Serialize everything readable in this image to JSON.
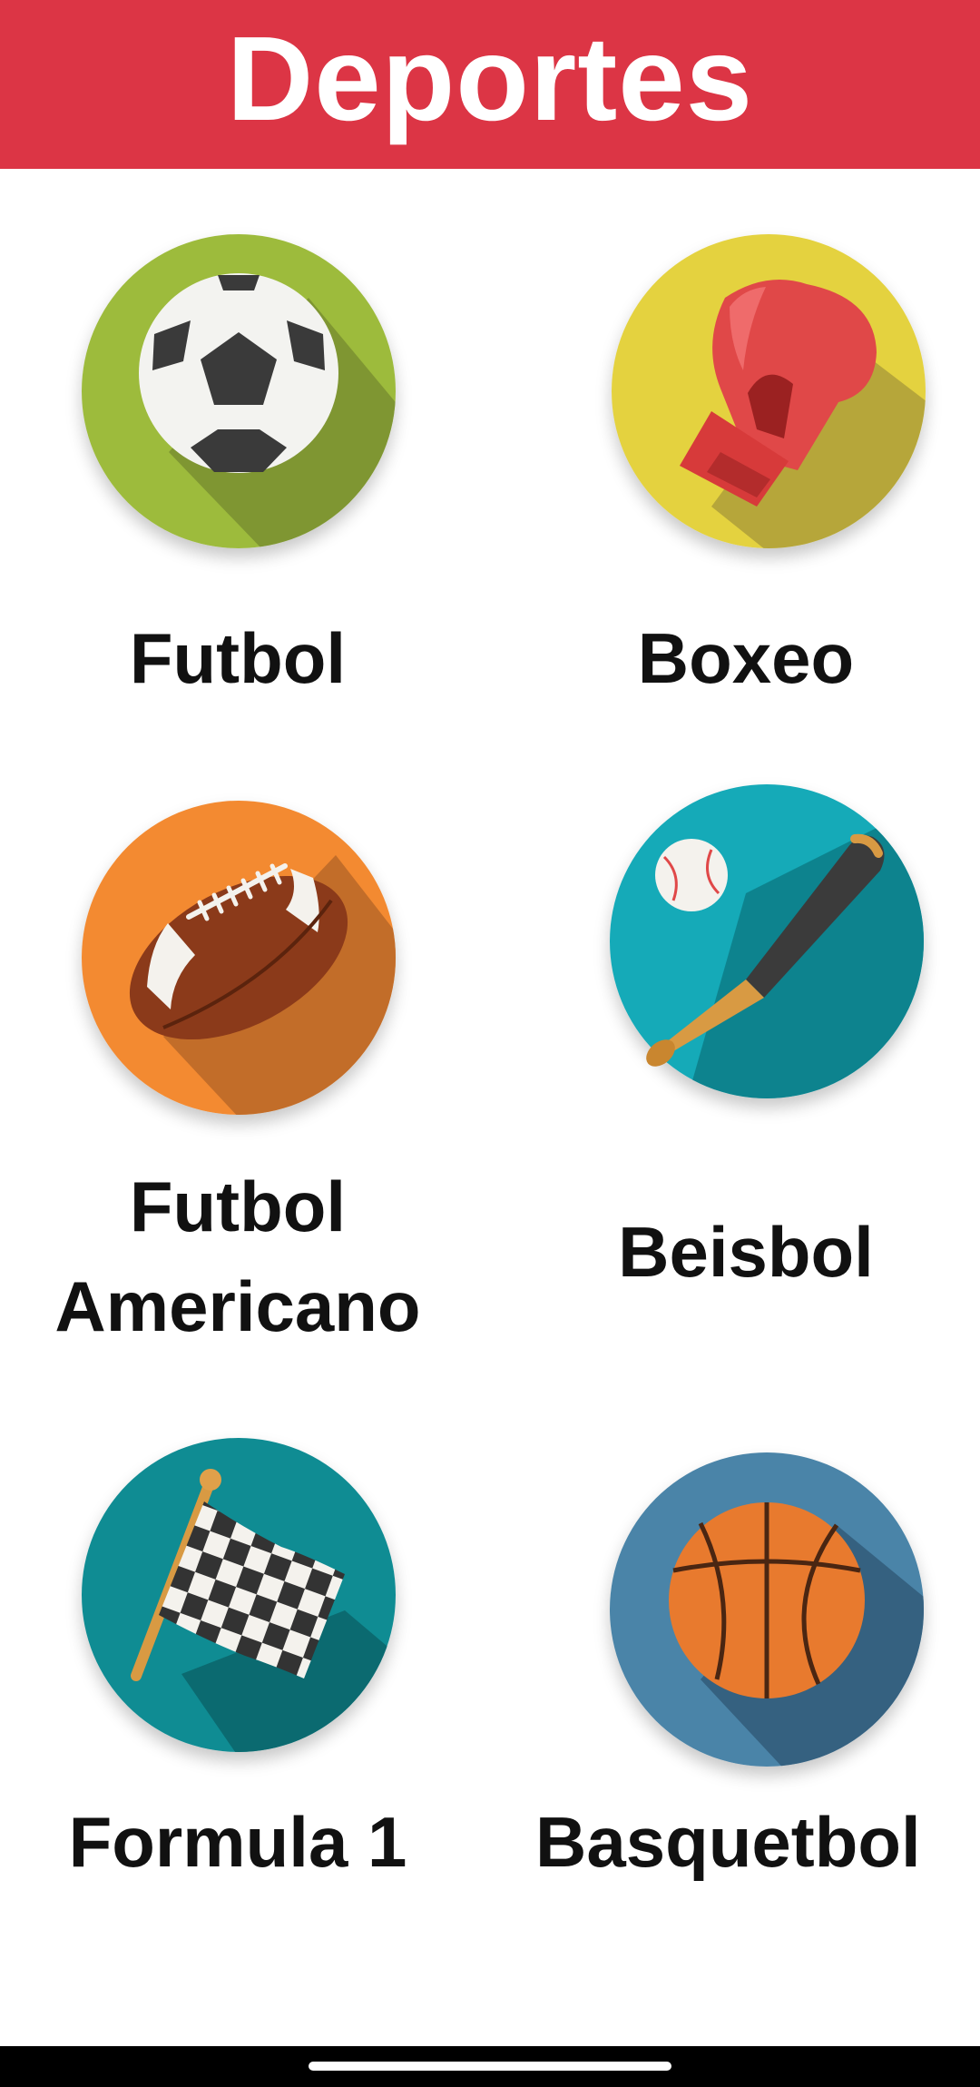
{
  "header": {
    "title": "Deportes",
    "color": "#dc3545"
  },
  "sports": [
    {
      "label": "Futbol",
      "icon": "soccer-ball-icon",
      "bg": "#9dbb3c"
    },
    {
      "label": "Boxeo",
      "icon": "boxing-glove-icon",
      "bg": "#e4d23f"
    },
    {
      "label_line1": "Futbol",
      "label_line2": "Americano",
      "icon": "american-football-icon",
      "bg": "#f38a31"
    },
    {
      "label": "Beisbol",
      "icon": "baseball-bat-icon",
      "bg": "#15aab8"
    },
    {
      "label": "Formula 1",
      "icon": "checkered-flag-icon",
      "bg": "#0f8c93"
    },
    {
      "label": "Basquetbol",
      "icon": "basketball-icon",
      "bg": "#4a84a8"
    }
  ]
}
